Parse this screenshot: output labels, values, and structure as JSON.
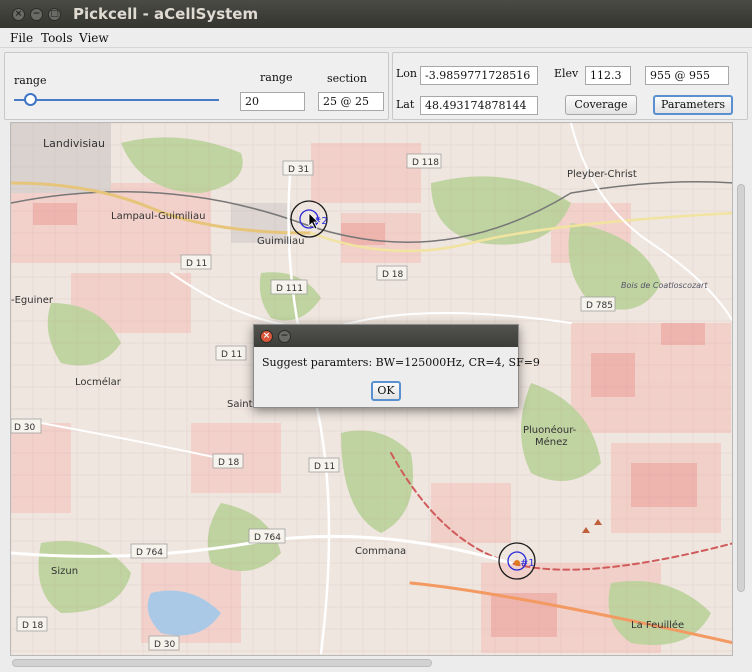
{
  "window": {
    "title": "Pickcell - aCellSystem"
  },
  "menu": [
    "File",
    "Tools",
    "View"
  ],
  "range_panel": {
    "slider_label": "range",
    "slider_value": 0.08,
    "range_label": "range",
    "range_value": "20",
    "section_label": "section",
    "section_value": "25 @ 25"
  },
  "coords_panel": {
    "lon_label": "Lon",
    "lon_value": "-3.9859771728516",
    "lat_label": "Lat",
    "lat_value": "48.493174878144",
    "elev_label": "Elev",
    "elev_value": "112.3",
    "cell_value": "955 @ 955",
    "coverage_button": "Coverage",
    "parameters_button": "Parameters"
  },
  "map": {
    "places": [
      "Landivisiau",
      "Lampaul-Guimiliau",
      "Guimiliau",
      "Pleyber-Christ",
      "Bois de Coatloscozart",
      "-Eguiner",
      "Locmélar",
      "Saint-",
      "Pluonéour-",
      "Ménez",
      "Sizun",
      "Commana",
      "La Feuillée"
    ],
    "roads": [
      "D 31",
      "D 118",
      "D 11",
      "D 111",
      "D 18",
      "D 785",
      "D 11",
      "D 30",
      "D 18",
      "D 11",
      "D 764",
      "D 764",
      "D 18",
      "D 30"
    ],
    "markers": [
      {
        "label": "#2"
      },
      {
        "label": "#1"
      }
    ]
  },
  "dialog": {
    "message": "Suggest paramters: BW=125000Hz, CR=4, SF=9",
    "ok_label": "OK"
  },
  "colors": {
    "titlebar": "#3b3b37",
    "focus_blue": "#5a8fd0",
    "marker_ring": "#1a1a1a",
    "marker_inner": "#2a2ad8"
  }
}
